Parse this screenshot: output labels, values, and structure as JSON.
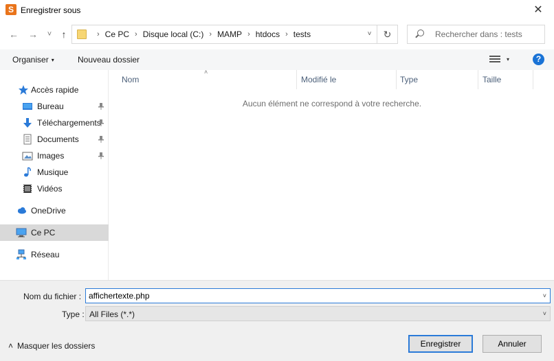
{
  "window": {
    "title": "Enregistrer sous",
    "app_icon_glyph": "S",
    "close_glyph": "✕"
  },
  "nav": {
    "back_glyph": "←",
    "forward_glyph": "→",
    "recent_glyph": "˅",
    "up_glyph": "↑"
  },
  "address": {
    "crumbs": [
      "Ce PC",
      "Disque local (C:)",
      "MAMP",
      "htdocs",
      "tests"
    ],
    "separator": "›",
    "dropdown_glyph": "˅",
    "refresh_glyph": "↻"
  },
  "search": {
    "placeholder": "Rechercher dans : tests"
  },
  "toolbar": {
    "organize_label": "Organiser",
    "new_folder_label": "Nouveau dossier",
    "help_glyph": "?",
    "dropdown_glyph": "▾"
  },
  "sidebar": {
    "quick_access": "Accès rapide",
    "items": [
      {
        "label": "Bureau",
        "icon": "desktop-icon",
        "pinned": true
      },
      {
        "label": "Téléchargements",
        "icon": "download-icon",
        "pinned": true
      },
      {
        "label": "Documents",
        "icon": "document-icon",
        "pinned": true
      },
      {
        "label": "Images",
        "icon": "image-icon",
        "pinned": true
      },
      {
        "label": "Musique",
        "icon": "music-icon",
        "pinned": false
      },
      {
        "label": "Vidéos",
        "icon": "video-icon",
        "pinned": false
      }
    ],
    "onedrive": "OneDrive",
    "this_pc": "Ce PC",
    "network": "Réseau",
    "pin_glyph": "📌"
  },
  "columns": {
    "name": "Nom",
    "modified": "Modifié le",
    "type": "Type",
    "size": "Taille",
    "sort_glyph": "˄"
  },
  "empty_message": "Aucun élément ne correspond à votre recherche.",
  "form": {
    "filename_label": "Nom du fichier :",
    "filename_value": "affichertexte.php",
    "type_label": "Type :",
    "type_value": "All Files (*.*)",
    "dropdown_glyph": "˅"
  },
  "footer": {
    "hide_folders_label": "Masquer les dossiers",
    "hide_glyph": "˄",
    "save_label": "Enregistrer",
    "cancel_label": "Annuler"
  },
  "colors": {
    "accent": "#2a7ad8",
    "selected_bg": "#d9d9d9",
    "toolbar_bg": "#f5f6f7",
    "footer_bg": "#f0f0f0"
  }
}
